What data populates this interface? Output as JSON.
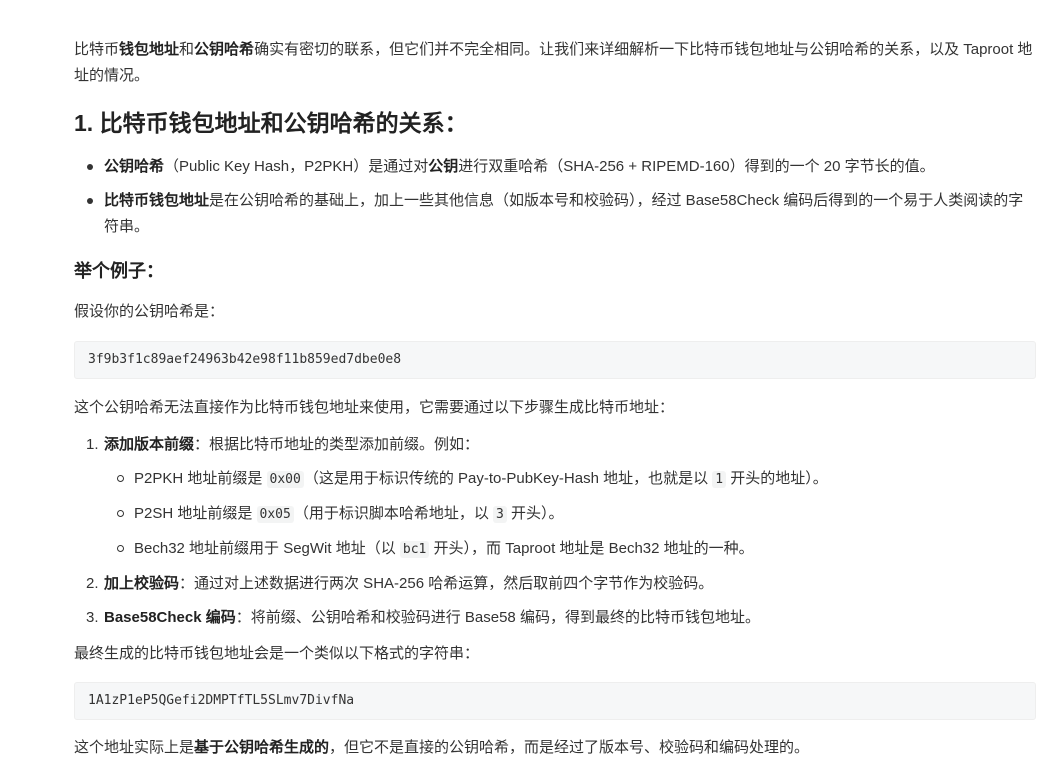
{
  "intro": {
    "t1": "比特币",
    "b1": "钱包地址",
    "t2": "和",
    "b2": "公钥哈希",
    "t3": "确实有密切的联系，但它们并不完全相同。让我们来详细解析一下比特币钱包地址与公钥哈希的关系，以及 Taproot 地址的情况。"
  },
  "section1": {
    "heading": "1. 比特币钱包地址和公钥哈希的关系：",
    "bullets": [
      {
        "b1": "公钥哈希",
        "t1": "（Public Key Hash，P2PKH）是通过对",
        "b2": "公钥",
        "t2": "进行双重哈希（SHA-256 + RIPEMD-160）得到的一个 20 字节长的值。"
      },
      {
        "b1": "比特币钱包地址",
        "t1": "是在公钥哈希的基础上，加上一些其他信息（如版本号和校验码），经过 Base58Check 编码后得到的一个易于人类阅读的字符串。"
      }
    ]
  },
  "example": {
    "heading": "举个例子：",
    "assume_text": "假设你的公钥哈希是：",
    "pubkey_hash": "3f9b3f1c89aef24963b42e98f11b859ed7dbe0e8",
    "cannot_use_text": "这个公钥哈希无法直接作为比特币钱包地址来使用，它需要通过以下步骤生成比特币地址：",
    "steps": [
      {
        "num": "1.",
        "title": "添加版本前缀",
        "text": "：根据比特币地址的类型添加前缀。例如：",
        "sub": [
          {
            "t1": "P2PKH 地址前缀是 ",
            "code1": "0x00",
            "t2": "（这是用于标识传统的 Pay-to-PubKey-Hash 地址，也就是以 ",
            "code2": "1",
            "t3": " 开头的地址）。"
          },
          {
            "t1": "P2SH 地址前缀是 ",
            "code1": "0x05",
            "t2": "（用于标识脚本哈希地址，以 ",
            "code2": "3",
            "t3": " 开头）。"
          },
          {
            "t1": "Bech32 地址前缀用于 SegWit 地址（以 ",
            "code1": "bc1",
            "t2": " 开头），而 Taproot 地址是 Bech32 地址的一种。"
          }
        ]
      },
      {
        "num": "2.",
        "title": "加上校验码",
        "text": "：通过对上述数据进行两次 SHA-256 哈希运算，然后取前四个字节作为校验码。"
      },
      {
        "num": "3.",
        "title": "Base58Check 编码",
        "text": "：将前缀、公钥哈希和校验码进行 Base58 编码，得到最终的比特币钱包地址。"
      }
    ],
    "final_text": "最终生成的比特币钱包地址会是一个类似以下格式的字符串：",
    "address": "1A1zP1eP5QGefi2DMPTfTL5SLmv7DivfNa",
    "conclusion": {
      "t1": "这个地址实际上是",
      "b1": "基于公钥哈希生成的",
      "t2": "，但它不是直接的公钥哈希，而是经过了版本号、校验码和编码处理的。"
    }
  }
}
